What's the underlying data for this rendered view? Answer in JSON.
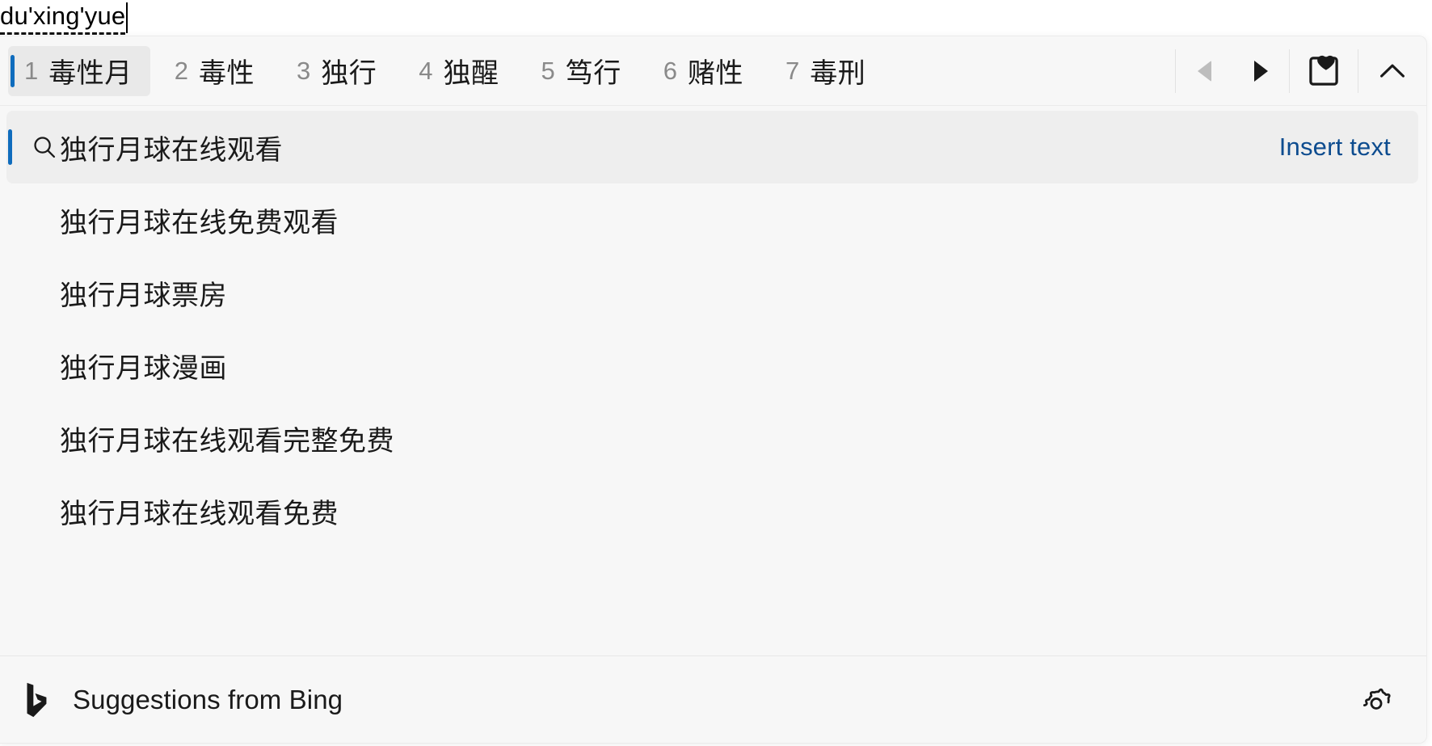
{
  "composition": {
    "text": "du'xing'yue"
  },
  "candidate_bar": {
    "candidates": [
      {
        "index": "1",
        "text": "毒性月",
        "selected": true
      },
      {
        "index": "2",
        "text": "毒性",
        "selected": false
      },
      {
        "index": "3",
        "text": "独行",
        "selected": false
      },
      {
        "index": "4",
        "text": "独醒",
        "selected": false
      },
      {
        "index": "5",
        "text": "笃行",
        "selected": false
      },
      {
        "index": "6",
        "text": "赌性",
        "selected": false
      },
      {
        "index": "7",
        "text": "毒刑",
        "selected": false
      }
    ],
    "prev_page_enabled": false,
    "next_page_enabled": true,
    "icons": {
      "prev": "triangle-left-icon",
      "next": "triangle-right-icon",
      "emoji": "emoji-sticker-heart-icon",
      "collapse": "chevron-up-icon"
    }
  },
  "suggestions": {
    "items": [
      {
        "text": "独行月球在线观看",
        "active": true,
        "has_search_icon": true,
        "action_label": "Insert text"
      },
      {
        "text": "独行月球在线免费观看",
        "active": false,
        "has_search_icon": false,
        "action_label": ""
      },
      {
        "text": "独行月球票房",
        "active": false,
        "has_search_icon": false,
        "action_label": ""
      },
      {
        "text": "独行月球漫画",
        "active": false,
        "has_search_icon": false,
        "action_label": ""
      },
      {
        "text": "独行月球在线观看完整免费",
        "active": false,
        "has_search_icon": false,
        "action_label": ""
      },
      {
        "text": "独行月球在线观看免费",
        "active": false,
        "has_search_icon": false,
        "action_label": ""
      }
    ]
  },
  "footer": {
    "label": "Suggestions from Bing",
    "logo_icon": "bing-logo-icon",
    "settings_icon": "gear-icon"
  },
  "colors": {
    "accent": "#0f6cbd",
    "link": "#0d4c8f",
    "panel_bg": "#f7f7f7",
    "selected_bg": "#e9e9e9",
    "text": "#1a1a1a",
    "index_text": "#8a8a8a"
  }
}
